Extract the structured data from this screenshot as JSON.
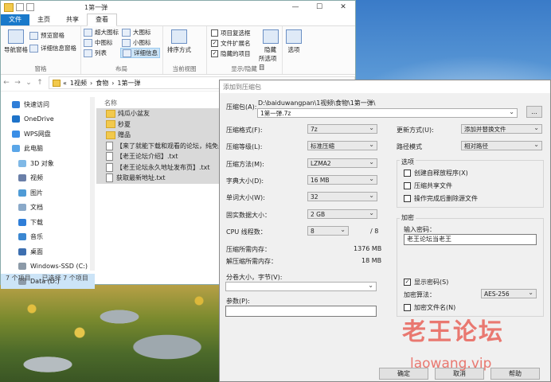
{
  "explorer": {
    "title": "1第一弹",
    "tabs": [
      "文件",
      "主页",
      "共享",
      "查看"
    ],
    "ribbon": {
      "panes": {
        "nav_pane": "导航窗格",
        "preview_pane": "预览窗格",
        "details_pane": "详细信息窗格",
        "label": "窗格"
      },
      "layout": {
        "xl_icons": "超大图标",
        "large_icons": "大图标",
        "medium_icons": "中图标",
        "small_icons": "小图标",
        "list": "列表",
        "details": "详细信息",
        "label": "布局"
      },
      "current_view": {
        "sort": "排序方式",
        "label": "当前视图"
      },
      "show_hide": {
        "item_checkboxes": "项目复选框",
        "file_ext": "文件扩展名",
        "hidden_items": "隐藏的项目",
        "hide_selected": "隐藏",
        "hide_selected2": "所选项目",
        "label": "显示/隐藏"
      },
      "options": "选项"
    },
    "breadcrumb": [
      "«",
      "1视频",
      "食物",
      "1第一弹"
    ],
    "sidebar": [
      "快速访问",
      "OneDrive",
      "WPS网盘",
      "此电脑",
      "3D 对象",
      "视频",
      "图片",
      "文档",
      "下载",
      "音乐",
      "桌面",
      "Windows-SSD (C:)",
      "Data (D:)"
    ],
    "column_name": "名称",
    "files": [
      {
        "name": "炖瓜小盆友",
        "type": "folder"
      },
      {
        "name": "秒夏",
        "type": "folder"
      },
      {
        "name": "赠品",
        "type": "folder"
      },
      {
        "name": "【来了就能下载和观看的论坛，纯免费!",
        "type": "txt"
      },
      {
        "name": "【老王论坛介绍】.txt",
        "type": "txt"
      },
      {
        "name": "【老王论坛永久地址发布页】.txt",
        "type": "txt"
      },
      {
        "name": "获取最新地址.txt",
        "type": "txt"
      }
    ],
    "status": {
      "count": "7 个项目",
      "selected": "已选择 7 个项目"
    }
  },
  "dialog": {
    "title": "添加到压缩包",
    "archive_label": "压缩包(A):",
    "archive_path": "D:\\baiduwangpan\\1视频\\食物\\1第一弹\\",
    "archive_name": "1第一弹.7z",
    "browse": "...",
    "format": {
      "label": "压缩格式(F):",
      "value": "7z"
    },
    "level": {
      "label": "压缩等级(L):",
      "value": "标准压缩"
    },
    "method": {
      "label": "压缩方法(M):",
      "value": "LZMA2"
    },
    "dict": {
      "label": "字典大小(D):",
      "value": "16 MB"
    },
    "word": {
      "label": "单词大小(W):",
      "value": "32"
    },
    "solid": {
      "label": "固实数据大小：",
      "value": "2 GB"
    },
    "threads": {
      "label": "CPU 线程数：",
      "value": "8",
      "total": "/ 8"
    },
    "mem_compress": {
      "label": "压缩所需内存：",
      "value": "1376 MB"
    },
    "mem_decompress": {
      "label": "解压缩所需内存：",
      "value": "18 MB"
    },
    "split": {
      "label": "分卷大小，字节(V):"
    },
    "params": {
      "label": "参数(P):"
    },
    "update": {
      "label": "更新方式(U):",
      "value": "添加并替换文件"
    },
    "path_mode": {
      "label": "路径模式",
      "value": "相对路径"
    },
    "options": {
      "label": "选项",
      "sfx": "创建自释放程序(X)",
      "shared": "压缩共享文件",
      "delete": "操作完成后删除源文件"
    },
    "encryption": {
      "label": "加密",
      "password_label": "输入密码：",
      "password": "老王论坛当老王",
      "show_password": "显示密码(S)",
      "method_label": "加密算法：",
      "method": "AES-256",
      "encrypt_names": "加密文件名(N)"
    },
    "buttons": {
      "ok": "确定",
      "cancel": "取消",
      "help": "帮助"
    }
  },
  "watermark": {
    "cn": "老王论坛",
    "en": "laowang.vip"
  }
}
